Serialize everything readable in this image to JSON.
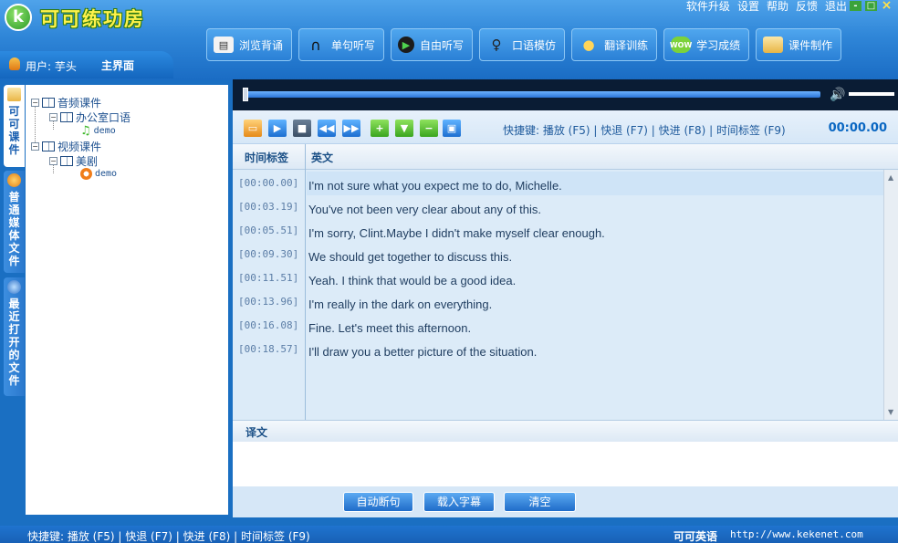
{
  "app": {
    "logo_letter": "k",
    "title": "可可练功房"
  },
  "top_menu": [
    "软件升级",
    "设置",
    "帮助",
    "反馈",
    "退出"
  ],
  "window_controls": {
    "minimize": "-",
    "restore": "□",
    "close": "×"
  },
  "user": {
    "label": "用户: 芋头",
    "main_interface": "主界面"
  },
  "toolbar": [
    {
      "label": "浏览背诵",
      "icon": "book-icon"
    },
    {
      "label": "单句听写",
      "icon": "headphones-icon"
    },
    {
      "label": "自由听写",
      "icon": "play-circle-icon"
    },
    {
      "label": "口语模仿",
      "icon": "microphone-icon"
    },
    {
      "label": "翻译训练",
      "icon": "person-icon"
    },
    {
      "label": "学习成绩",
      "icon": "wow-badge-icon"
    },
    {
      "label": "课件制作",
      "icon": "folder-icon"
    }
  ],
  "left_tabs": [
    "可可课件",
    "普通媒体文件",
    "最近打开的文件"
  ],
  "tree": {
    "audio": {
      "label": "音频课件",
      "child": "办公室口语",
      "leaf": "demo"
    },
    "video": {
      "label": "视频课件",
      "child": "美剧",
      "leaf": "demo"
    }
  },
  "player": {
    "volume_icon": "speaker-icon",
    "position": 0.0
  },
  "controls": {
    "buttons": [
      "open-folder",
      "play",
      "stop",
      "rewind",
      "fast-forward",
      "add",
      "down",
      "remove",
      "save"
    ],
    "shortcuts": "快捷键:  播放 (F5) | 快退 (F7) | 快进 (F8) | 时间标签 (F9)",
    "time": "00:00.00"
  },
  "grid": {
    "headers": {
      "timestamp": "时间标签",
      "english": "英文"
    },
    "rows": [
      {
        "ts": "[00:00.00]",
        "en": "I'm not sure what you expect me to do, Michelle."
      },
      {
        "ts": "[00:03.19]",
        "en": "You've not been very clear about any of this."
      },
      {
        "ts": "[00:05.51]",
        "en": "I'm sorry, Clint.Maybe I didn't make myself clear enough."
      },
      {
        "ts": "[00:09.30]",
        "en": "We should get together to discuss this."
      },
      {
        "ts": "[00:11.51]",
        "en": "Yeah. I think that would be a good idea."
      },
      {
        "ts": "[00:13.96]",
        "en": "I'm really in the dark on everything."
      },
      {
        "ts": "[00:16.08]",
        "en": "Fine. Let's meet this afternoon."
      },
      {
        "ts": "[00:18.57]",
        "en": "I'll draw you a better picture of the situation."
      }
    ]
  },
  "translation": {
    "label": "译文"
  },
  "bottom_buttons": [
    "自动断句",
    "载入字幕",
    "清空"
  ],
  "status": {
    "shortcuts": "快捷键:  播放 (F5) | 快退 (F7) | 快进 (F8) | 时间标签 (F9)",
    "brand": "可可英语",
    "url": "http://www.kekenet.com"
  }
}
